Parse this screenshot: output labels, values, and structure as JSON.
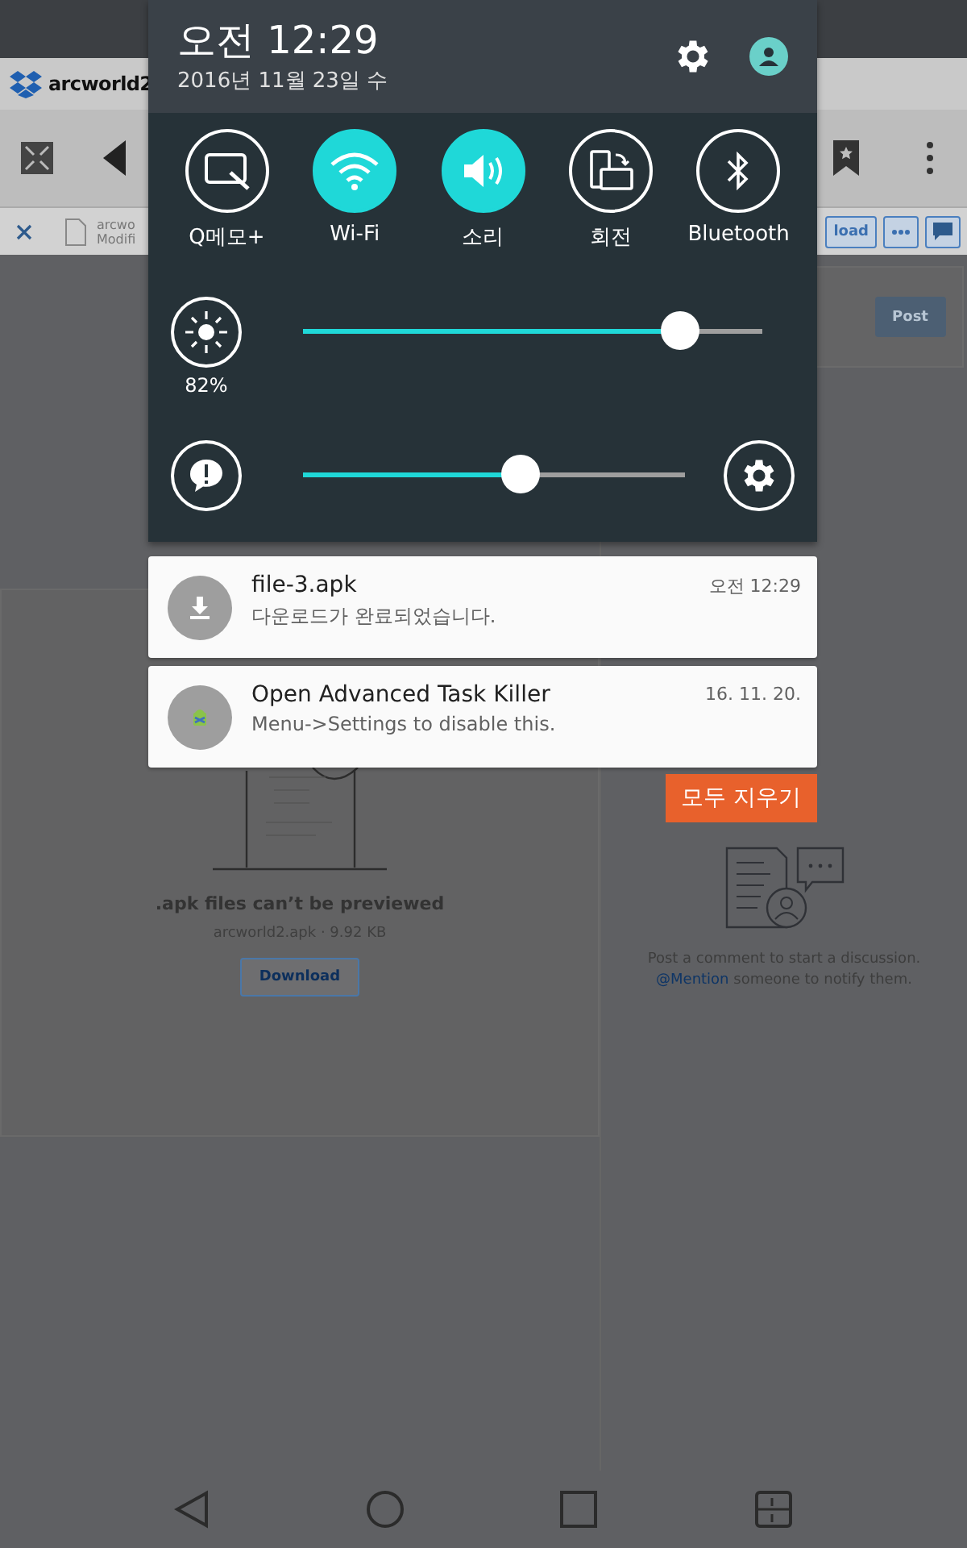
{
  "shade": {
    "time": "오전 12:29",
    "date": "2016년 11월 23일 수"
  },
  "quick_settings": [
    {
      "kind": "memo",
      "label": "Q메모+",
      "on": false
    },
    {
      "kind": "wifi",
      "label": "Wi-Fi",
      "on": true
    },
    {
      "kind": "sound",
      "label": "소리",
      "on": true
    },
    {
      "kind": "rotate",
      "label": "회전",
      "on": false
    },
    {
      "kind": "bluetooth",
      "label": "Bluetooth",
      "on": false
    }
  ],
  "brightness": {
    "level": 0.82,
    "reading": "82%"
  },
  "volume": {
    "level": 0.57
  },
  "notifications": [
    {
      "kind": "download",
      "title": "file-3.apk",
      "text": "다운로드가 완료되었습니다.",
      "time": "오전 12:29"
    },
    {
      "kind": "app",
      "title": "Open Advanced Task Killer",
      "text": "Menu->Settings to disable this.",
      "time": "16. 11. 20."
    }
  ],
  "clear_all": "모두 지우기",
  "background_page": {
    "title": "arcworld2",
    "file_name": "arcwo",
    "file_meta": "Modifi",
    "download_button_partial": "load",
    "post_button": "Post",
    "preview_message": ".apk files can’t be previewed",
    "file_info": "arcworld2.apk · 9.92 KB",
    "download_button": "Download",
    "comment_hint": "Post a comment to start a discussion.",
    "mention_link": "@Mention",
    "comment_hint_tail": " someone to notify them."
  }
}
